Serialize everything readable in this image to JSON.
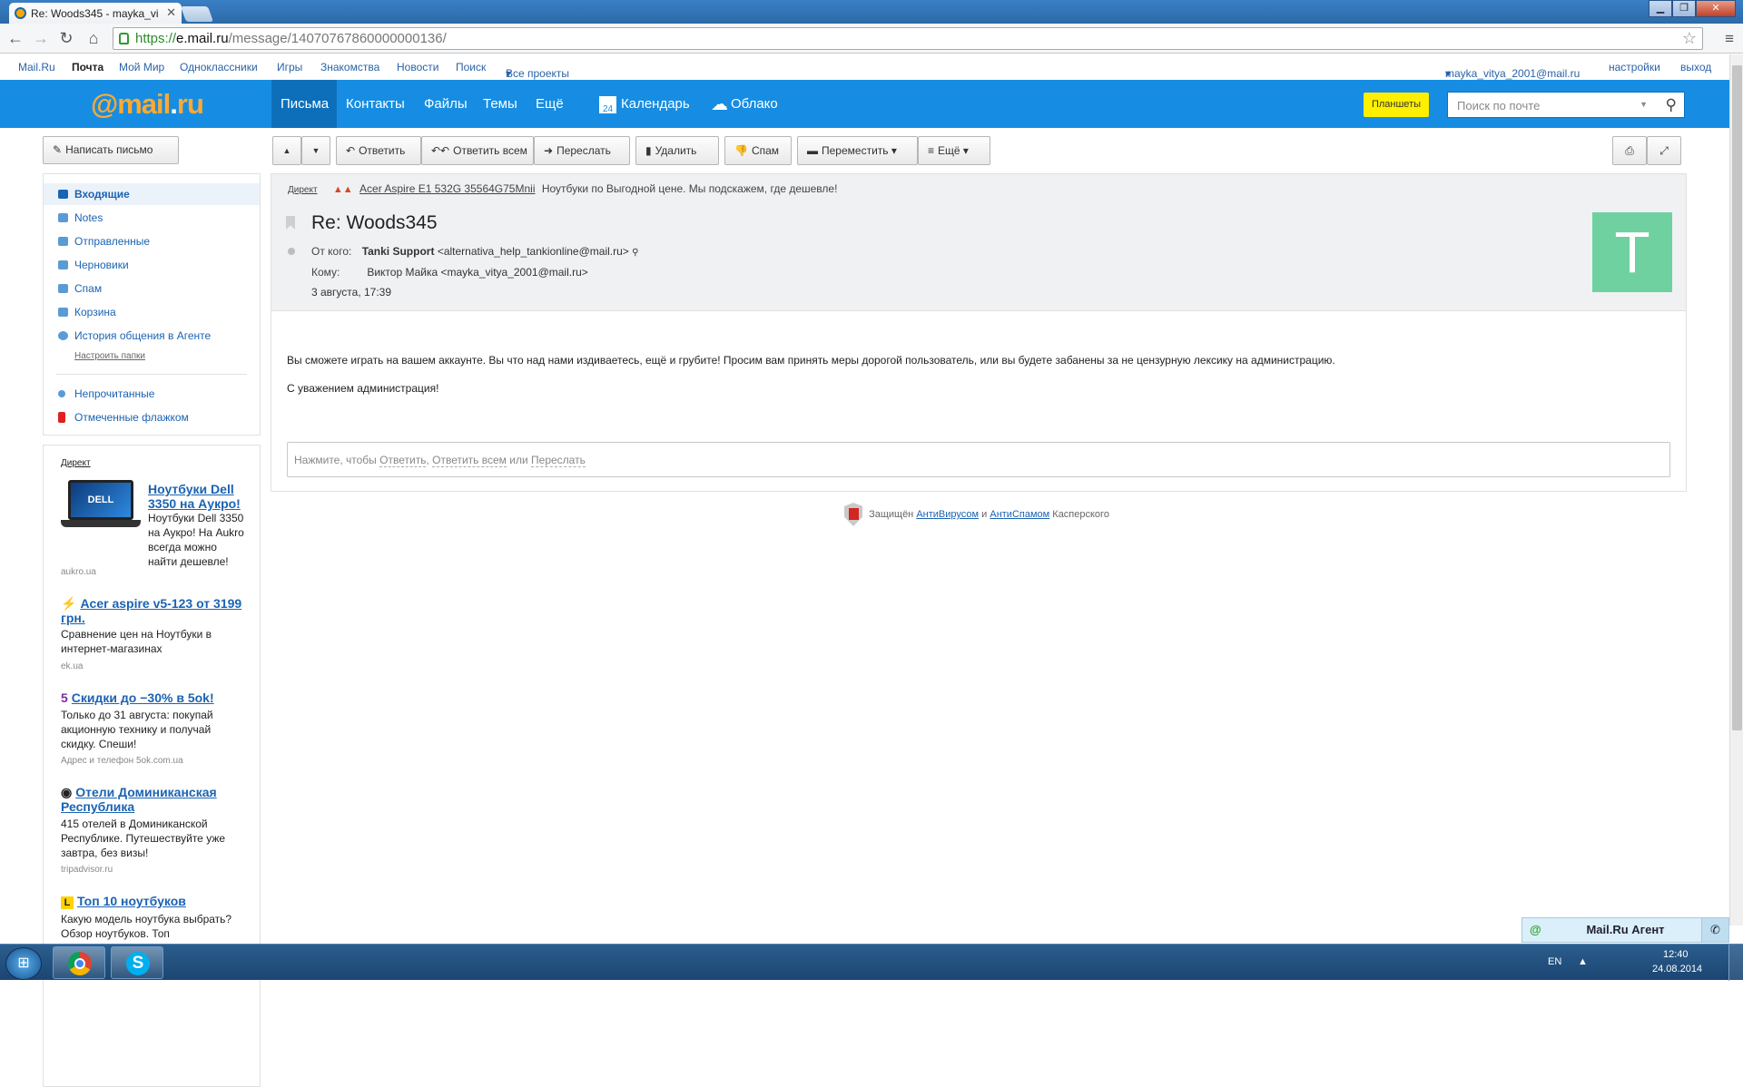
{
  "browser": {
    "tab_title": "Re: Woods345 - mayka_vi",
    "url_scheme": "https://",
    "url_host": "e.mail.ru",
    "url_path": "/message/14070767860000000136/"
  },
  "toplinks": {
    "left": [
      "Mail.Ru",
      "Почта",
      "Мой Мир",
      "Одноклассники",
      "Игры",
      "Знакомства",
      "Новости",
      "Поиск",
      "Все проекты"
    ],
    "user": "mayka_vitya_2001@mail.ru",
    "settings": "настройки",
    "logout": "выход"
  },
  "header": {
    "logo_at": "@",
    "logo_text": "mail",
    "logo_dot": ".",
    "logo_tld": "ru",
    "nav": [
      "Письма",
      "Контакты",
      "Файлы",
      "Темы",
      "Ещё"
    ],
    "calendar_day": "24",
    "calendar": "Календарь",
    "cloud": "Облако",
    "tablets": "Планшеты",
    "search_placeholder": "Поиск по почте"
  },
  "compose": "Написать письмо",
  "folders": [
    {
      "label": "Входящие",
      "icon": "inbox-icon",
      "color": "#1b63b3"
    },
    {
      "label": "Notes",
      "icon": "folder-icon",
      "color": "#5b9bd5"
    },
    {
      "label": "Отправленные",
      "icon": "sent-icon",
      "color": "#5b9bd5"
    },
    {
      "label": "Черновики",
      "icon": "drafts-icon",
      "color": "#5b9bd5"
    },
    {
      "label": "Спам",
      "icon": "spam-icon",
      "color": "#5b9bd5"
    },
    {
      "label": "Корзина",
      "icon": "trash-icon",
      "color": "#5b9bd5"
    },
    {
      "label": "История общения в Агенте",
      "icon": "agent-history-icon",
      "color": "#5b9bd5"
    }
  ],
  "folders_setup": "Настроить папки",
  "filters": [
    {
      "label": "Непрочитанные",
      "icon": "unread-dot-icon",
      "color": "#5b9bd5"
    },
    {
      "label": "Отмеченные флажком",
      "icon": "flag-icon",
      "color": "#e02020"
    }
  ],
  "ads": {
    "header": "Директ",
    "items": [
      {
        "title": "Ноутбуки Dell 3350 на Аукро!",
        "text": "Ноутбуки Dell 3350 на Аукро! На Aukro всегда можно найти дешевле!",
        "source": "aukro.ua"
      },
      {
        "title": "Acer aspire v5-123 от 3199 грн.",
        "text": "Сравнение цен на Ноутбуки в интернет-магазинах",
        "source": "ek.ua"
      },
      {
        "title": "Скидки до −30% в 5ok!",
        "text": "Только до 31 августа: покупай акционную технику и получай скидку. Спеши!",
        "source": "Адрес и телефон  5ok.com.ua"
      },
      {
        "title": "Отели Доминиканская Республика",
        "text": "415 отелей в Доминиканской Республике. Путешествуйте уже завтра, без визы!",
        "source": "tripadvisor.ru"
      },
      {
        "title": "Топ 10 ноутбуков",
        "text": "Какую модель ноутбука выбрать? Обзор ноутбуков. Топ",
        "source": ""
      }
    ]
  },
  "actions": {
    "up": "▲",
    "down": "▼",
    "reply": "Ответить",
    "reply_all": "Ответить всем",
    "forward": "Переслать",
    "delete": "Удалить",
    "spam": "Спам",
    "move": "Переместить",
    "more": "Ещё"
  },
  "message": {
    "direct_label": "Директ",
    "direct_link": "Acer Aspire E1 532G 35564G75Mnii",
    "direct_text": "Ноутбуки по Выгодной цене. Мы подскажем, где дешевле!",
    "subject": "Re: Woods345",
    "from_label": "От кого:",
    "from_name": "Tanki Support",
    "from_email": "<alternativa_help_tankionline@mail.ru>",
    "to_label": "Кому:",
    "to": "Виктор Майка <mayka_vitya_2001@mail.ru>",
    "date": "3 августа, 17:39",
    "avatar_letter": "T",
    "body": "Вы сможете играть на вашем аккаунте. Вы что над нами издиваетесь, ещё и грубите! Просим вам принять меры дорогой пользователь, или вы будете забанены за не цензурную лексику на администрацию.",
    "signature": "С уважением администрация!",
    "reply_prompt": "Нажмите, чтобы",
    "reply_link": "Ответить",
    "reply_all_link": "Ответить всем",
    "or": "или",
    "forward_link": "Переслать"
  },
  "kaspersky": {
    "prefix": "Защищён",
    "antivirus": "АнтиВирусом",
    "and": "и",
    "antispam": "АнтиСпамом",
    "suffix": "Касперского"
  },
  "agent": "Mail.Ru Агент",
  "taskbar": {
    "lang": "EN",
    "time": "12:40",
    "date": "24.08.2014"
  }
}
